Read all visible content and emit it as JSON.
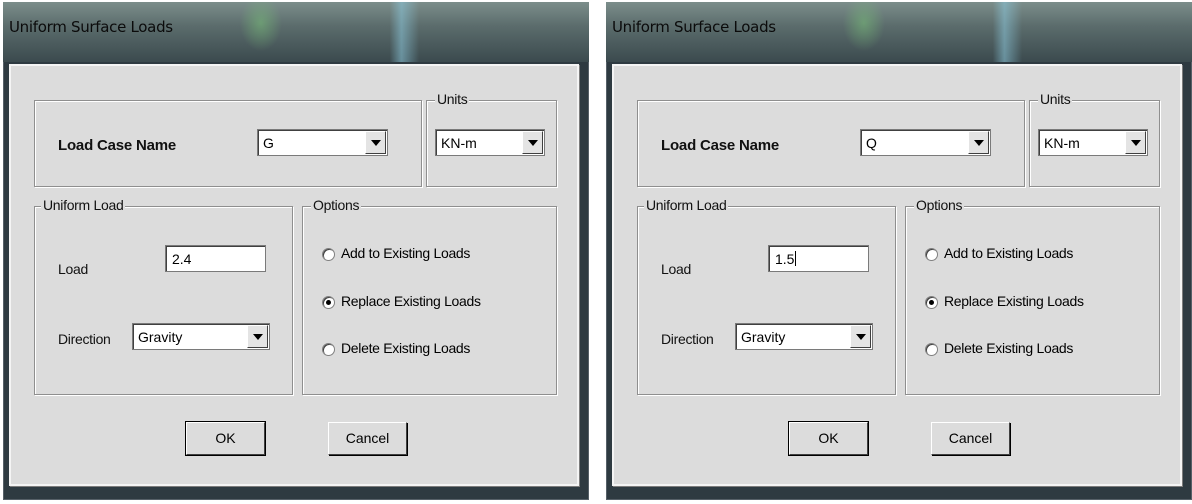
{
  "dialogs": [
    {
      "title": "Uniform Surface Loads",
      "load_case_label": "Load Case Name",
      "load_case_value": "G",
      "units_legend": "Units",
      "units_value": "KN-m",
      "uniform_load_legend": "Uniform Load",
      "load_label": "Load",
      "load_value": "2.4",
      "direction_label": "Direction",
      "direction_value": "Gravity",
      "options_legend": "Options",
      "options": [
        "Add to Existing Loads",
        "Replace Existing Loads",
        "Delete Existing Loads"
      ],
      "selected_option": 1,
      "ok_label": "OK",
      "cancel_label": "Cancel"
    },
    {
      "title": "Uniform Surface Loads",
      "load_case_label": "Load Case Name",
      "load_case_value": "Q",
      "units_legend": "Units",
      "units_value": "KN-m",
      "uniform_load_legend": "Uniform Load",
      "load_label": "Load",
      "load_value": "1.5",
      "direction_label": "Direction",
      "direction_value": "Gravity",
      "options_legend": "Options",
      "options": [
        "Add to Existing Loads",
        "Replace Existing Loads",
        "Delete Existing Loads"
      ],
      "selected_option": 1,
      "ok_label": "OK",
      "cancel_label": "Cancel"
    }
  ]
}
